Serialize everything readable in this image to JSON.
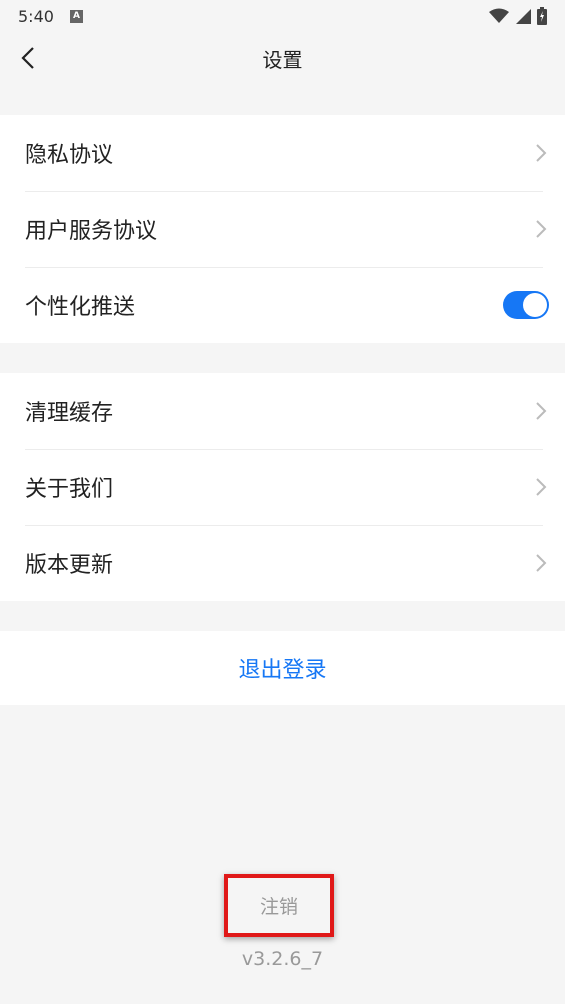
{
  "status_bar": {
    "time": "5:40",
    "notification_badge": "A"
  },
  "header": {
    "title": "设置"
  },
  "groups": [
    {
      "items": [
        {
          "label": "隐私协议"
        },
        {
          "label": "用户服务协议"
        },
        {
          "label": "个性化推送",
          "toggle_on": true
        }
      ]
    },
    {
      "items": [
        {
          "label": "清理缓存"
        },
        {
          "label": "关于我们"
        },
        {
          "label": "版本更新"
        }
      ]
    }
  ],
  "logout_label": "退出登录",
  "cancel_account_label": "注销",
  "version": "v3.2.6_7",
  "colors": {
    "accent": "#1677f5",
    "highlight_border": "#e01818"
  }
}
